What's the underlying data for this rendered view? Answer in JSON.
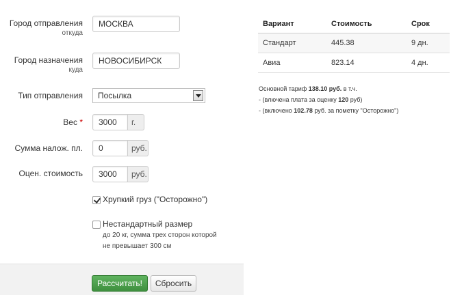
{
  "form": {
    "from": {
      "label": "Город отправления",
      "sublabel": "откуда",
      "value": "МОСКВА"
    },
    "to": {
      "label": "Город назначения",
      "sublabel": "куда",
      "value": "НОВОСИБИРСК"
    },
    "type": {
      "label": "Тип отправления",
      "value": "Посылка"
    },
    "weight": {
      "label": "Вес",
      "required_mark": "*",
      "value": "3000",
      "unit": "г."
    },
    "cod": {
      "label": "Сумма налож. пл.",
      "value": "0",
      "unit": "руб."
    },
    "declared": {
      "label": "Оцен. стоимость",
      "value": "3000",
      "unit": "руб."
    },
    "fragile": {
      "label": "Хрупкий груз (\"Осторожно\")",
      "checked": true
    },
    "nonstandard": {
      "label": "Нестандартный размер",
      "checked": false,
      "hint": "до 20 кг, сумма трех сторон которой не превышает 300 см"
    },
    "calculate_label": "Рассчитать!",
    "reset_label": "Сбросить"
  },
  "results": {
    "headers": [
      "Вариант",
      "Стоимость",
      "Срок"
    ],
    "rows": [
      [
        "Стандарт",
        "445.38",
        "9 дн."
      ],
      [
        "Авиа",
        "823.14",
        "4 дн."
      ]
    ]
  },
  "notes": {
    "line1_pre": "Основной тариф ",
    "line1_bold": "138.10 руб.",
    "line1_post": " в т.ч.",
    "line2_pre": "- (влючена плата за оценку ",
    "line2_bold": "120",
    "line2_post": " руб)",
    "line3_pre": "- (включено ",
    "line3_bold": "102.78",
    "line3_post": " руб. за пометку \"Осторожно\")"
  },
  "colors": {
    "primary_button": "#4a9f4a",
    "footer_bg": "#f2f2f2"
  }
}
